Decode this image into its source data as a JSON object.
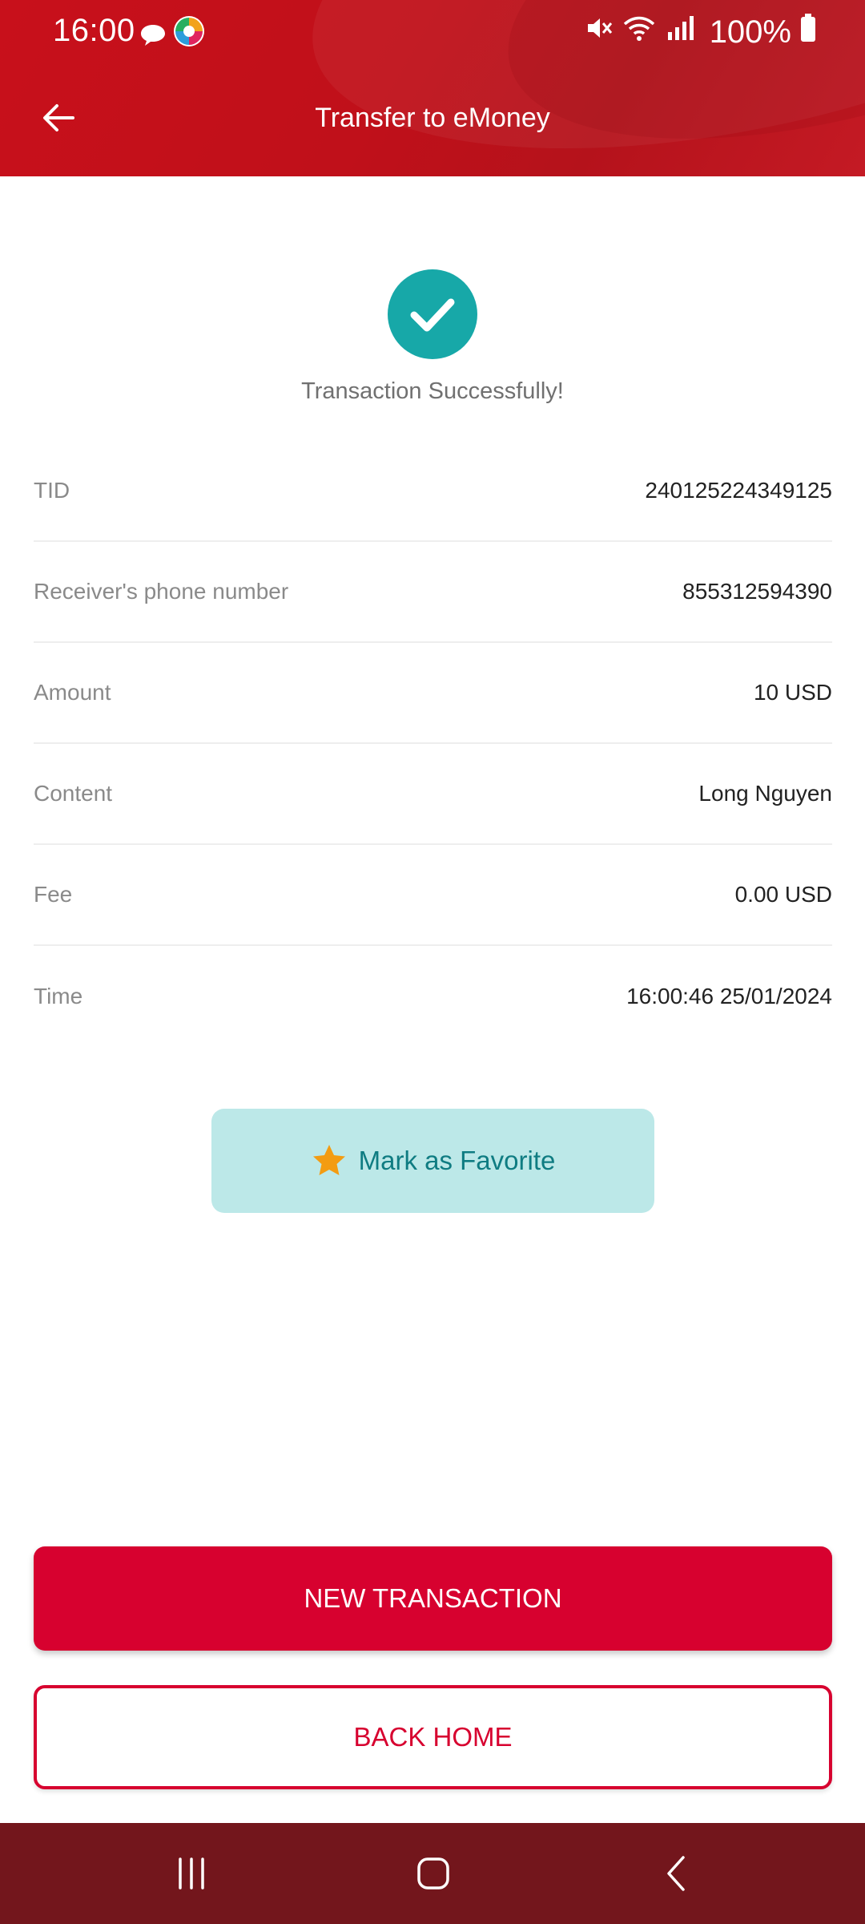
{
  "status_bar": {
    "time": "16:00",
    "battery": "100%",
    "icons": [
      "chat-bubble-icon",
      "app-notification-icon",
      "mute-icon",
      "wifi-icon",
      "signal-icon",
      "battery-icon"
    ]
  },
  "app_bar": {
    "title": "Transfer to eMoney",
    "back_icon": "arrow-left-icon"
  },
  "result": {
    "icon": "check-circle-icon",
    "message": "Transaction Successfully!",
    "accent_color": "#17a8a8"
  },
  "details": [
    {
      "label": "TID",
      "value": "240125224349125"
    },
    {
      "label": "Receiver's phone number",
      "value": "855312594390"
    },
    {
      "label": "Amount",
      "value": "10 USD"
    },
    {
      "label": "Content",
      "value": "Long Nguyen"
    },
    {
      "label": "Fee",
      "value": "0.00 USD"
    },
    {
      "label": "Time",
      "value": "16:00:46 25/01/2024"
    }
  ],
  "favorite": {
    "label": "Mark as Favorite",
    "icon": "star-icon",
    "icon_color": "#f39c12"
  },
  "actions": {
    "new_transaction": "NEW TRANSACTION",
    "back_home": "BACK HOME",
    "primary_color": "#d7012f"
  },
  "nav_bar": {
    "icons": [
      "recents-icon",
      "home-icon",
      "back-icon"
    ]
  }
}
